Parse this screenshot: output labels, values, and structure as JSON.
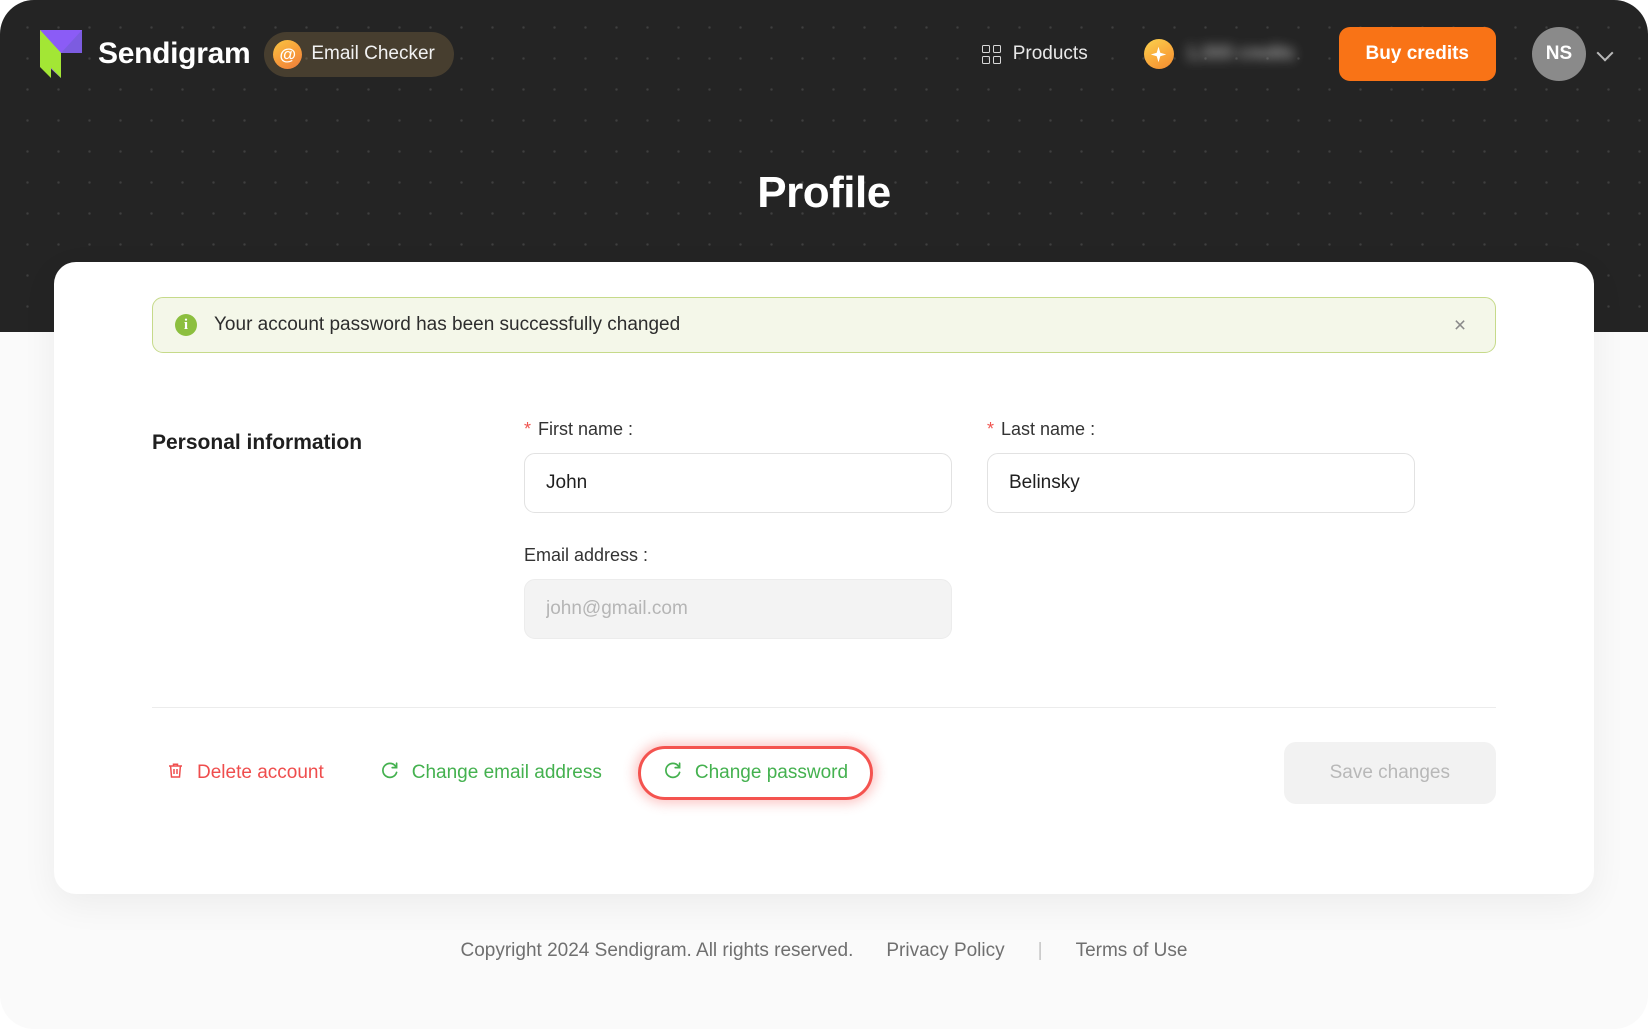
{
  "header": {
    "brand_name": "Sendigram",
    "product_pill": {
      "badge": "@",
      "label": "Email Checker"
    },
    "products_link": "Products",
    "credits_amount": "1,000 credits",
    "buy_credits_label": "Buy credits",
    "avatar_initials": "NS"
  },
  "hero": {
    "title": "Profile"
  },
  "alert": {
    "message": "Your account password has been successfully changed",
    "icon": "i",
    "close_label": "×",
    "bg_color": "#f4f7e9",
    "border_color": "#c6da8a",
    "icon_color": "#8cbf3f"
  },
  "form": {
    "section_title": "Personal information",
    "first_name": {
      "label": "First name :",
      "required_marker": "*",
      "value": "John",
      "placeholder": "First name"
    },
    "last_name": {
      "label": "Last name :",
      "required_marker": "*",
      "value": "Belinsky",
      "placeholder": "Last name"
    },
    "email": {
      "label": "Email address :",
      "value": "",
      "placeholder": "john@gmail.com"
    }
  },
  "actions": {
    "delete_account": "Delete account",
    "change_email": "Change email address",
    "change_password": "Change password",
    "save_changes": "Save changes",
    "danger_color": "#ef4d4d",
    "green_color": "#44b14f",
    "highlight_color": "#f4534f"
  },
  "footer": {
    "copyright": "Copyright 2024 Sendigram. All rights reserved.",
    "privacy_policy": "Privacy Policy",
    "separator": "|",
    "terms_of_use": "Terms of Use"
  }
}
